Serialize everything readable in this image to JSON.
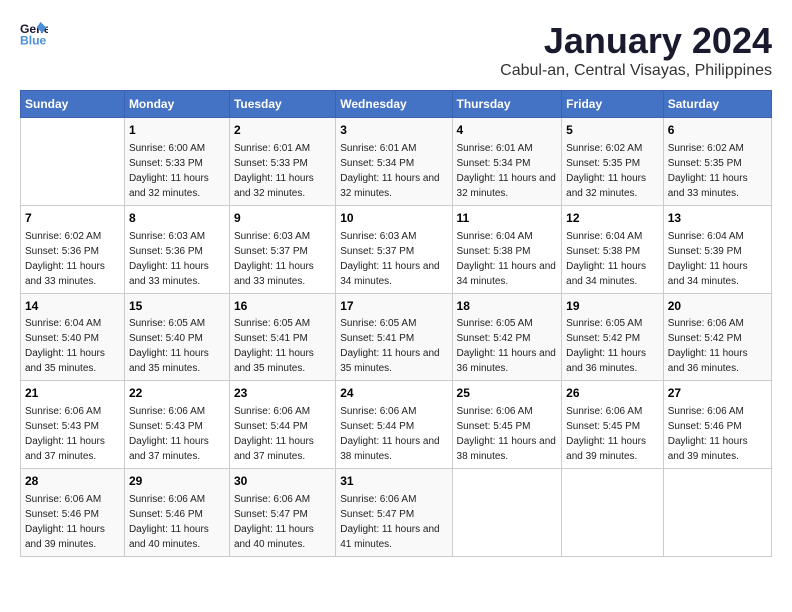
{
  "header": {
    "logo_line1": "General",
    "logo_line2": "Blue",
    "title": "January 2024",
    "subtitle": "Cabul-an, Central Visayas, Philippines"
  },
  "calendar": {
    "days_of_week": [
      "Sunday",
      "Monday",
      "Tuesday",
      "Wednesday",
      "Thursday",
      "Friday",
      "Saturday"
    ],
    "weeks": [
      [
        {
          "day": "",
          "sunrise": "",
          "sunset": "",
          "daylight": ""
        },
        {
          "day": "1",
          "sunrise": "Sunrise: 6:00 AM",
          "sunset": "Sunset: 5:33 PM",
          "daylight": "Daylight: 11 hours and 32 minutes."
        },
        {
          "day": "2",
          "sunrise": "Sunrise: 6:01 AM",
          "sunset": "Sunset: 5:33 PM",
          "daylight": "Daylight: 11 hours and 32 minutes."
        },
        {
          "day": "3",
          "sunrise": "Sunrise: 6:01 AM",
          "sunset": "Sunset: 5:34 PM",
          "daylight": "Daylight: 11 hours and 32 minutes."
        },
        {
          "day": "4",
          "sunrise": "Sunrise: 6:01 AM",
          "sunset": "Sunset: 5:34 PM",
          "daylight": "Daylight: 11 hours and 32 minutes."
        },
        {
          "day": "5",
          "sunrise": "Sunrise: 6:02 AM",
          "sunset": "Sunset: 5:35 PM",
          "daylight": "Daylight: 11 hours and 32 minutes."
        },
        {
          "day": "6",
          "sunrise": "Sunrise: 6:02 AM",
          "sunset": "Sunset: 5:35 PM",
          "daylight": "Daylight: 11 hours and 33 minutes."
        }
      ],
      [
        {
          "day": "7",
          "sunrise": "Sunrise: 6:02 AM",
          "sunset": "Sunset: 5:36 PM",
          "daylight": "Daylight: 11 hours and 33 minutes."
        },
        {
          "day": "8",
          "sunrise": "Sunrise: 6:03 AM",
          "sunset": "Sunset: 5:36 PM",
          "daylight": "Daylight: 11 hours and 33 minutes."
        },
        {
          "day": "9",
          "sunrise": "Sunrise: 6:03 AM",
          "sunset": "Sunset: 5:37 PM",
          "daylight": "Daylight: 11 hours and 33 minutes."
        },
        {
          "day": "10",
          "sunrise": "Sunrise: 6:03 AM",
          "sunset": "Sunset: 5:37 PM",
          "daylight": "Daylight: 11 hours and 34 minutes."
        },
        {
          "day": "11",
          "sunrise": "Sunrise: 6:04 AM",
          "sunset": "Sunset: 5:38 PM",
          "daylight": "Daylight: 11 hours and 34 minutes."
        },
        {
          "day": "12",
          "sunrise": "Sunrise: 6:04 AM",
          "sunset": "Sunset: 5:38 PM",
          "daylight": "Daylight: 11 hours and 34 minutes."
        },
        {
          "day": "13",
          "sunrise": "Sunrise: 6:04 AM",
          "sunset": "Sunset: 5:39 PM",
          "daylight": "Daylight: 11 hours and 34 minutes."
        }
      ],
      [
        {
          "day": "14",
          "sunrise": "Sunrise: 6:04 AM",
          "sunset": "Sunset: 5:40 PM",
          "daylight": "Daylight: 11 hours and 35 minutes."
        },
        {
          "day": "15",
          "sunrise": "Sunrise: 6:05 AM",
          "sunset": "Sunset: 5:40 PM",
          "daylight": "Daylight: 11 hours and 35 minutes."
        },
        {
          "day": "16",
          "sunrise": "Sunrise: 6:05 AM",
          "sunset": "Sunset: 5:41 PM",
          "daylight": "Daylight: 11 hours and 35 minutes."
        },
        {
          "day": "17",
          "sunrise": "Sunrise: 6:05 AM",
          "sunset": "Sunset: 5:41 PM",
          "daylight": "Daylight: 11 hours and 35 minutes."
        },
        {
          "day": "18",
          "sunrise": "Sunrise: 6:05 AM",
          "sunset": "Sunset: 5:42 PM",
          "daylight": "Daylight: 11 hours and 36 minutes."
        },
        {
          "day": "19",
          "sunrise": "Sunrise: 6:05 AM",
          "sunset": "Sunset: 5:42 PM",
          "daylight": "Daylight: 11 hours and 36 minutes."
        },
        {
          "day": "20",
          "sunrise": "Sunrise: 6:06 AM",
          "sunset": "Sunset: 5:42 PM",
          "daylight": "Daylight: 11 hours and 36 minutes."
        }
      ],
      [
        {
          "day": "21",
          "sunrise": "Sunrise: 6:06 AM",
          "sunset": "Sunset: 5:43 PM",
          "daylight": "Daylight: 11 hours and 37 minutes."
        },
        {
          "day": "22",
          "sunrise": "Sunrise: 6:06 AM",
          "sunset": "Sunset: 5:43 PM",
          "daylight": "Daylight: 11 hours and 37 minutes."
        },
        {
          "day": "23",
          "sunrise": "Sunrise: 6:06 AM",
          "sunset": "Sunset: 5:44 PM",
          "daylight": "Daylight: 11 hours and 37 minutes."
        },
        {
          "day": "24",
          "sunrise": "Sunrise: 6:06 AM",
          "sunset": "Sunset: 5:44 PM",
          "daylight": "Daylight: 11 hours and 38 minutes."
        },
        {
          "day": "25",
          "sunrise": "Sunrise: 6:06 AM",
          "sunset": "Sunset: 5:45 PM",
          "daylight": "Daylight: 11 hours and 38 minutes."
        },
        {
          "day": "26",
          "sunrise": "Sunrise: 6:06 AM",
          "sunset": "Sunset: 5:45 PM",
          "daylight": "Daylight: 11 hours and 39 minutes."
        },
        {
          "day": "27",
          "sunrise": "Sunrise: 6:06 AM",
          "sunset": "Sunset: 5:46 PM",
          "daylight": "Daylight: 11 hours and 39 minutes."
        }
      ],
      [
        {
          "day": "28",
          "sunrise": "Sunrise: 6:06 AM",
          "sunset": "Sunset: 5:46 PM",
          "daylight": "Daylight: 11 hours and 39 minutes."
        },
        {
          "day": "29",
          "sunrise": "Sunrise: 6:06 AM",
          "sunset": "Sunset: 5:46 PM",
          "daylight": "Daylight: 11 hours and 40 minutes."
        },
        {
          "day": "30",
          "sunrise": "Sunrise: 6:06 AM",
          "sunset": "Sunset: 5:47 PM",
          "daylight": "Daylight: 11 hours and 40 minutes."
        },
        {
          "day": "31",
          "sunrise": "Sunrise: 6:06 AM",
          "sunset": "Sunset: 5:47 PM",
          "daylight": "Daylight: 11 hours and 41 minutes."
        },
        {
          "day": "",
          "sunrise": "",
          "sunset": "",
          "daylight": ""
        },
        {
          "day": "",
          "sunrise": "",
          "sunset": "",
          "daylight": ""
        },
        {
          "day": "",
          "sunrise": "",
          "sunset": "",
          "daylight": ""
        }
      ]
    ]
  }
}
